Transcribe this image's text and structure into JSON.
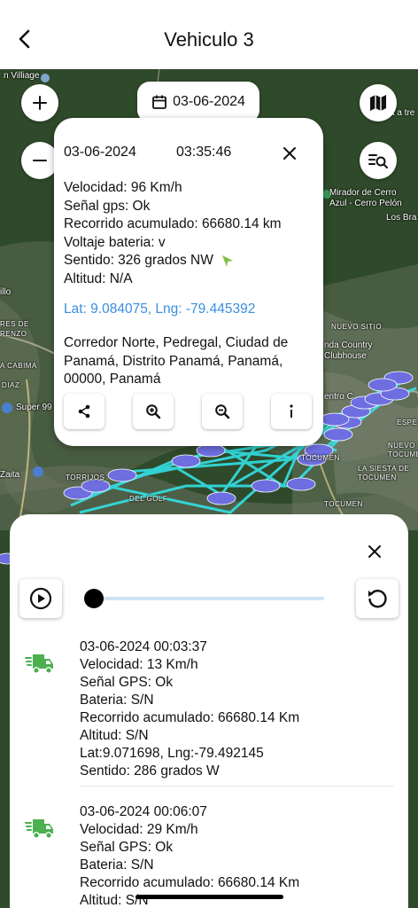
{
  "header": {
    "title": "Vehiculo 3"
  },
  "map": {
    "date_chip": "03-06-2024",
    "labels": {
      "village": "n Villiage",
      "atre": "a a tre",
      "mirador": "Mirador de Cerro\nAzul - Cerro Pelón",
      "losbra": "Los Bra",
      "illo": "illo",
      "nuevo_sitio": "NUEVO SITIO",
      "country": "nda Country\nClubhouse",
      "cabima": "A CABIMA",
      "diaz": "DIAZ",
      "super99": "Super 99",
      "zaita": "Zaita",
      "torrijos": "TORRIJOS",
      "espe": "ESPE",
      "tocumen1": "TOCUMEN",
      "tocumen2": "TOCUMEN",
      "siesta": "LA SIESTA DE\nTOCUMEN",
      "nuevo_tocumen": "NUEVO\nTOCUMEN",
      "delgolf": "DEL GOLF",
      "centro": "entro C",
      "ceres": "RES DE\nRENZO"
    }
  },
  "popup": {
    "date": "03-06-2024",
    "time": "03:35:46",
    "lines": [
      "Velocidad: 96 Km/h",
      "Señal gps: Ok",
      "Recorrido acumulado: 66680.14 km",
      "Voltaje bateria:  v",
      "Sentido: 326 grados NW",
      "Altitud: N/A"
    ],
    "latlng": "Lat: 9.084075, Lng: -79.445392",
    "address": "Corredor Norte, Pedregal, Ciudad de Panamá, Distrito Panamá, Panamá, 00000, Panamá",
    "direction_color": "#7cc242"
  },
  "records": [
    {
      "lines": [
        "03-06-2024 00:03:37",
        "Velocidad: 13 Km/h",
        "Señal GPS: Ok",
        "Bateria: S/N",
        "Recorrido acumulado: 66680.14 Km",
        "Altitud: S/N",
        "Lat:9.071698, Lng:-79.492145",
        "Sentido: 286 grados W"
      ]
    },
    {
      "lines": [
        "03-06-2024 00:06:07",
        "Velocidad: 29 Km/h",
        "Señal GPS: Ok",
        "Bateria: S/N",
        "Recorrido acumulado: 66680.14 Km",
        "Altitud: S/N"
      ]
    }
  ],
  "colors": {
    "route": "#33e0e6",
    "truck": "#4caf50",
    "latlng": "#3a8fe0",
    "car": "#6e6ee0"
  },
  "playback": {
    "progress": 0
  }
}
